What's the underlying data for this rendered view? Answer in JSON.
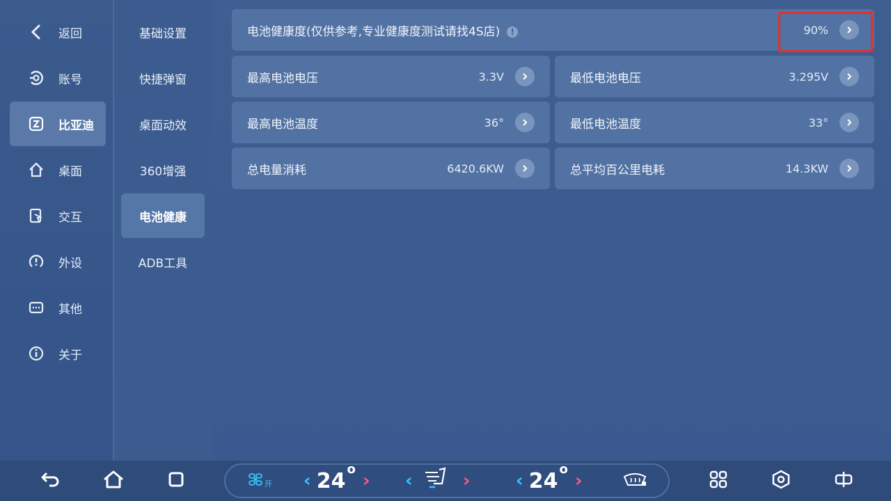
{
  "nav_primary": [
    {
      "label": "返回",
      "icon": "back-chevron-icon"
    },
    {
      "label": "账号",
      "icon": "account-icon"
    },
    {
      "label": "比亚迪",
      "icon": "byd-icon",
      "active": true
    },
    {
      "label": "桌面",
      "icon": "home-icon"
    },
    {
      "label": "交互",
      "icon": "interaction-icon"
    },
    {
      "label": "外设",
      "icon": "tire-pressure-icon"
    },
    {
      "label": "其他",
      "icon": "other-icon"
    },
    {
      "label": "关于",
      "icon": "info-icon"
    }
  ],
  "nav_secondary": [
    {
      "label": "基础设置"
    },
    {
      "label": "快捷弹窗"
    },
    {
      "label": "桌面动效"
    },
    {
      "label": "360增强"
    },
    {
      "label": "电池健康",
      "active": true
    },
    {
      "label": "ADB工具"
    }
  ],
  "battery": {
    "health": {
      "title": "电池健康度(仅供参考,专业健康度测试请找4S店)",
      "value": "90%"
    },
    "max_voltage": {
      "title": "最高电池电压",
      "value": "3.3V"
    },
    "min_voltage": {
      "title": "最低电池电压",
      "value": "3.295V"
    },
    "max_temp": {
      "title": "最高电池温度",
      "value": "36°"
    },
    "min_temp": {
      "title": "最低电池温度",
      "value": "33°"
    },
    "total_energy": {
      "title": "总电量消耗",
      "value": "6420.6KW"
    },
    "avg_per_100km": {
      "title": "总平均百公里电耗",
      "value": "14.3KW"
    }
  },
  "climate": {
    "fan_label": "开",
    "left_temp": "24",
    "right_temp": "24",
    "degree": "o"
  },
  "colors": {
    "highlight": "#e3302a",
    "active_nav": "#5a79a8",
    "cyan": "#35c6ff",
    "pink": "#ff5a7a"
  }
}
